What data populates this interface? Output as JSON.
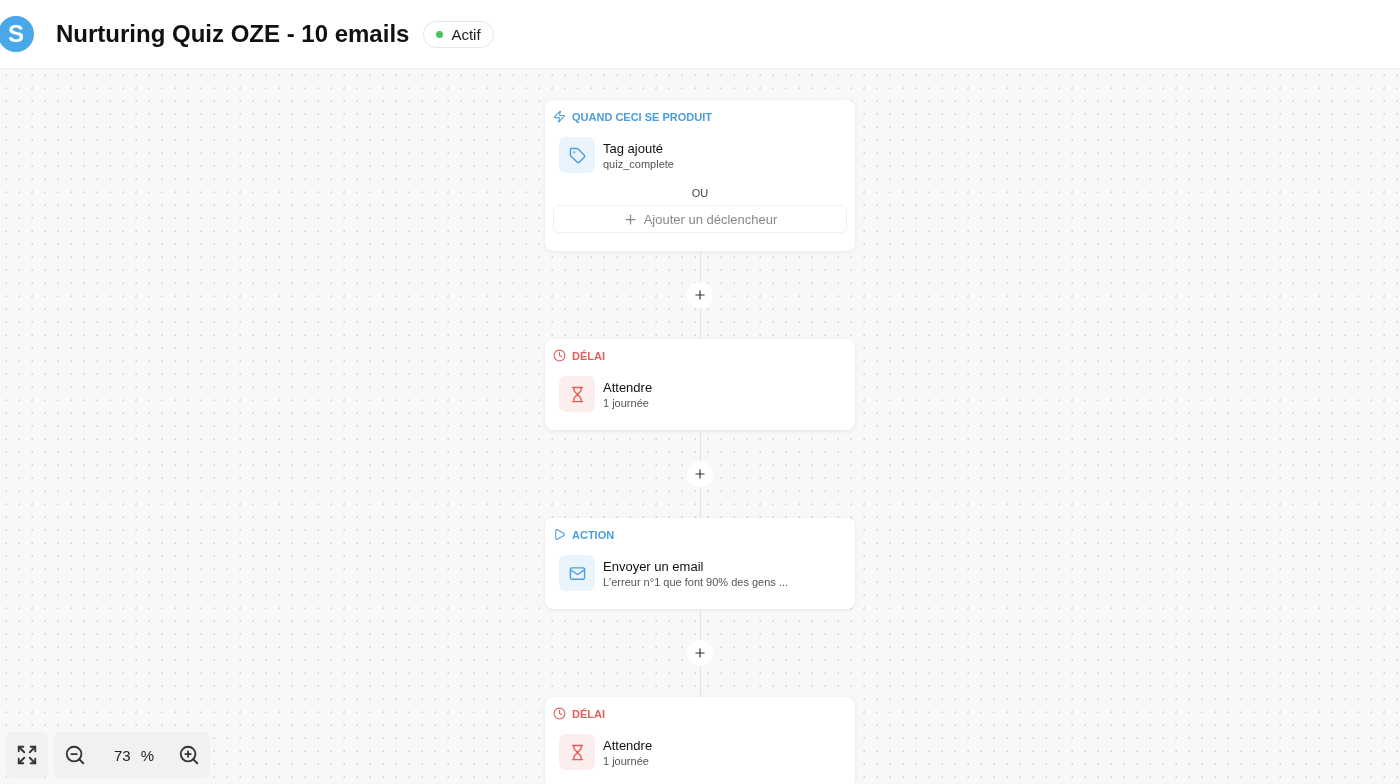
{
  "header": {
    "logo": "S",
    "title": "Nurturing Quiz OZE - 10 emails",
    "status": {
      "label": "Actif",
      "active": true
    }
  },
  "steps": [
    {
      "kind": "trigger",
      "heading": "QUAND CECI SE PRODUIT",
      "title": "Tag ajouté",
      "subtitle": "quiz_complete",
      "separator": "OU",
      "add_label": "Ajouter un déclencheur"
    },
    {
      "kind": "delay",
      "heading": "DÉLAI",
      "title": "Attendre",
      "subtitle": "1 journée"
    },
    {
      "kind": "action",
      "heading": "ACTION",
      "title": "Envoyer un email",
      "subtitle": "L'erreur n°1 que font 90% des gens ..."
    },
    {
      "kind": "delay",
      "heading": "DÉLAI",
      "title": "Attendre",
      "subtitle": "1 journée"
    }
  ],
  "zoom": {
    "value": "73",
    "unit": "%"
  }
}
